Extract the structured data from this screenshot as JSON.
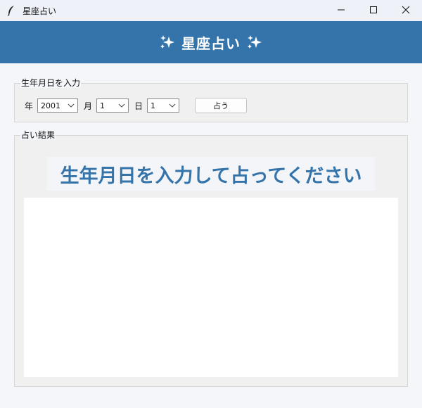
{
  "window": {
    "title": "星座占い",
    "icon": "feather-icon",
    "controls": [
      "minimize-icon",
      "maximize-icon",
      "close-icon"
    ]
  },
  "banner": {
    "title": "星座占い",
    "icon": "sparkles-icon",
    "background": "#3474aa"
  },
  "input_frame": {
    "label": "生年月日を入力",
    "year": {
      "label": "年",
      "value": "2001"
    },
    "month": {
      "label": "月",
      "value": "1"
    },
    "day": {
      "label": "日",
      "value": "1"
    },
    "button_label": "占う"
  },
  "result_frame": {
    "label": "占い結果",
    "heading": "生年月日を入力して占ってください",
    "heading_color": "#3474aa",
    "body": ""
  }
}
